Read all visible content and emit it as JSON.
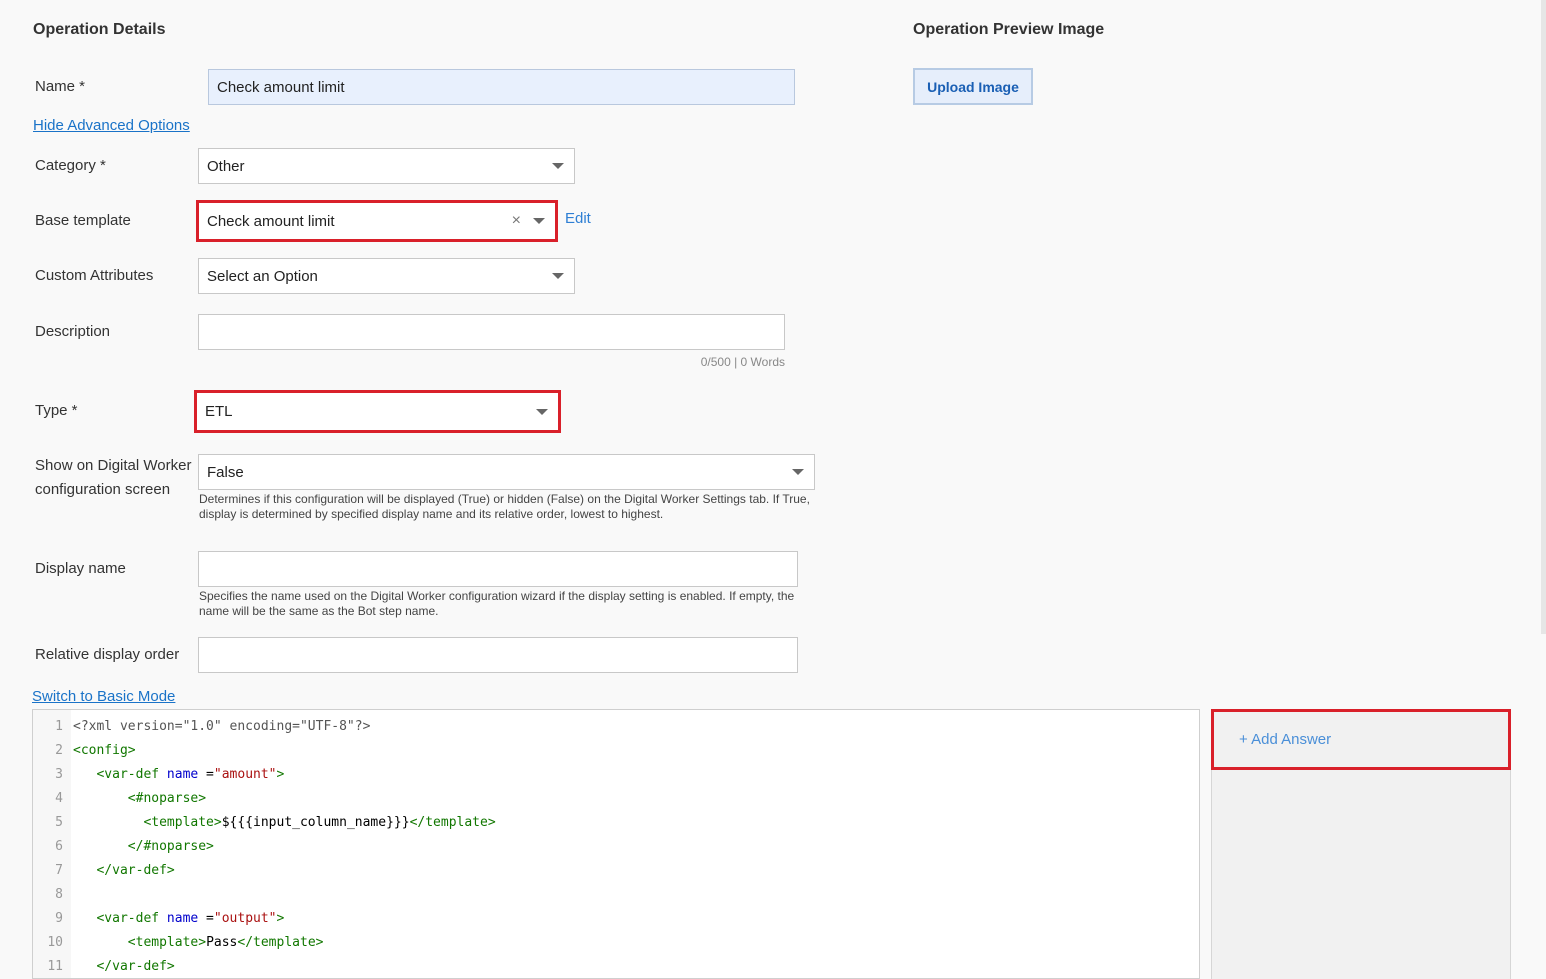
{
  "details": {
    "title": "Operation Details",
    "name_label": "Name *",
    "name_value": "Check amount limit",
    "hide_advanced_link": "Hide Advanced Options",
    "category_label": "Category *",
    "category_value": "Other",
    "base_template_label": "Base template",
    "base_template_value": "Check amount limit",
    "base_template_clear": "×",
    "edit_link": "Edit",
    "custom_attributes_label": "Custom Attributes",
    "custom_attributes_value": "Select an Option",
    "description_label": "Description",
    "description_value": "",
    "description_counter": "0/500 | 0 Words",
    "type_label": "Type *",
    "type_value": "ETL",
    "show_label": "Show on Digital Worker configuration screen",
    "show_value": "False",
    "show_help": "Determines if this configuration will be displayed (True) or hidden (False) on the Digital Worker Settings tab. If True, display is determined by specified display name and its relative order, lowest to highest.",
    "display_name_label": "Display name",
    "display_name_value": "",
    "display_name_help": "Specifies the name used on the Digital Worker configuration wizard if the display setting is enabled. If empty, the name will be the same as the Bot step name.",
    "relative_order_label": "Relative display order",
    "relative_order_value": "",
    "switch_mode_link": "Switch to Basic Mode"
  },
  "preview": {
    "title": "Operation Preview Image",
    "upload_button": "Upload Image"
  },
  "answers": {
    "add_answer": "+ Add Answer"
  },
  "editor": {
    "lines": [
      {
        "n": "1",
        "tokens": [
          {
            "t": "meta",
            "s": "<?xml version=\"1.0\" encoding=\"UTF-8\"?>"
          }
        ]
      },
      {
        "n": "2",
        "tokens": [
          {
            "t": "tag",
            "s": "<config>"
          }
        ]
      },
      {
        "n": "3",
        "tokens": [
          {
            "t": "tag",
            "s": "   <var-def "
          },
          {
            "t": "attr",
            "s": "name"
          },
          {
            "t": "text",
            "s": " ="
          },
          {
            "t": "str",
            "s": "\"amount\""
          },
          {
            "t": "tag",
            "s": ">"
          }
        ]
      },
      {
        "n": "4",
        "tokens": [
          {
            "t": "tag",
            "s": "       <#noparse>"
          }
        ]
      },
      {
        "n": "5",
        "tokens": [
          {
            "t": "tag",
            "s": "         <template>"
          },
          {
            "t": "text",
            "s": "${{{input_column_name}}}"
          },
          {
            "t": "tag",
            "s": "</template>"
          }
        ]
      },
      {
        "n": "6",
        "tokens": [
          {
            "t": "tag",
            "s": "       </#noparse>"
          }
        ]
      },
      {
        "n": "7",
        "tokens": [
          {
            "t": "tag",
            "s": "   </var-def>"
          }
        ]
      },
      {
        "n": "8",
        "tokens": []
      },
      {
        "n": "9",
        "tokens": [
          {
            "t": "tag",
            "s": "   <var-def "
          },
          {
            "t": "attr",
            "s": "name"
          },
          {
            "t": "text",
            "s": " ="
          },
          {
            "t": "str",
            "s": "\"output\""
          },
          {
            "t": "tag",
            "s": ">"
          }
        ]
      },
      {
        "n": "10",
        "tokens": [
          {
            "t": "tag",
            "s": "       <template>"
          },
          {
            "t": "text",
            "s": "Pass"
          },
          {
            "t": "tag",
            "s": "</template>"
          }
        ]
      },
      {
        "n": "11",
        "tokens": [
          {
            "t": "tag",
            "s": "   </var-def>"
          }
        ]
      }
    ]
  }
}
